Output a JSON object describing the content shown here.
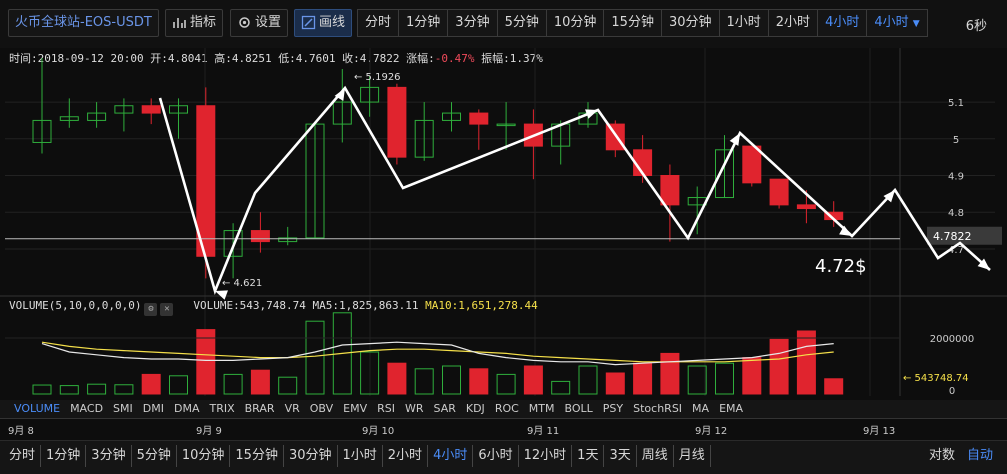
{
  "toolbar": {
    "title": "火币全球站-EOS-USDT",
    "indicators_label": "指标",
    "settings_label": "设置",
    "draw_label": "画线",
    "periods": [
      "分时",
      "1分钟",
      "3分钟",
      "5分钟",
      "10分钟",
      "15分钟",
      "30分钟",
      "1小时",
      "2小时",
      "4小时"
    ],
    "selected_period": "4小时",
    "period_dropdown": "4小时",
    "timer": "6秒"
  },
  "info_bar": {
    "time": "时间:2018-09-12 20:00",
    "open": "开:4.8041",
    "high": "高:4.8251",
    "low": "低:4.7601",
    "close": "收:4.7822",
    "change_label": "涨幅:",
    "change_value": "-0.47%",
    "amplitude": "振幅:1.37%"
  },
  "price_axis": {
    "ticks": [
      "5.1",
      "5",
      "4.9",
      "4.8",
      "4.7"
    ],
    "current_price": "4.7822",
    "annotation": "4.72$",
    "high_marker": "5.1926",
    "low_marker": "4.621"
  },
  "volume_bar": {
    "params": "VOLUME(5,10,0,0,0,0)",
    "volume": "VOLUME:543,748.74",
    "ma5": "MA5:1,825,863.11",
    "ma10": "MA10:1,651,278.44",
    "axis_tick": "2000000",
    "axis_zero": "0",
    "current_volume": "543748.74"
  },
  "indicator_tabs": [
    "VOLUME",
    "MACD",
    "SMI",
    "DMI",
    "DMA",
    "TRIX",
    "BRAR",
    "VR",
    "OBV",
    "EMV",
    "RSI",
    "WR",
    "SAR",
    "KDJ",
    "ROC",
    "MTM",
    "BOLL",
    "PSY",
    "StochRSI",
    "MA",
    "EMA"
  ],
  "selected_indicator": "VOLUME",
  "date_axis": [
    "9月 8",
    "9月 9",
    "9月 10",
    "9月 11",
    "9月 12",
    "9月 13"
  ],
  "bottom_periods": [
    "分时",
    "1分钟",
    "3分钟",
    "5分钟",
    "10分钟",
    "15分钟",
    "30分钟",
    "1小时",
    "2小时",
    "4小时",
    "6小时",
    "12小时",
    "1天",
    "3天",
    "周线",
    "月线"
  ],
  "bottom_selected": "4小时",
  "bottom_right": [
    "对数",
    "自动"
  ],
  "bottom_right_selected": "自动",
  "colors": {
    "up": "#2fae3c",
    "down": "#e0242e",
    "ma5": "#e8e8e8",
    "ma10": "#f5e04a",
    "accent": "#4a8cf7"
  },
  "chart_data": {
    "type": "candlestick",
    "candles": [
      {
        "o": 4.99,
        "h": 5.22,
        "l": 4.96,
        "c": 5.05,
        "v": 320000
      },
      {
        "o": 5.05,
        "h": 5.11,
        "l": 5.03,
        "c": 5.06,
        "v": 300000
      },
      {
        "o": 5.05,
        "h": 5.1,
        "l": 5.03,
        "c": 5.07,
        "v": 350000
      },
      {
        "o": 5.07,
        "h": 5.11,
        "l": 5.02,
        "c": 5.09,
        "v": 330000
      },
      {
        "o": 5.09,
        "h": 5.11,
        "l": 5.04,
        "c": 5.07,
        "v": 700000
      },
      {
        "o": 5.07,
        "h": 5.11,
        "l": 5.0,
        "c": 5.09,
        "v": 650000
      },
      {
        "o": 5.09,
        "h": 5.14,
        "l": 4.62,
        "c": 4.68,
        "v": 2300000
      },
      {
        "o": 4.68,
        "h": 4.77,
        "l": 4.62,
        "c": 4.75,
        "v": 700000
      },
      {
        "o": 4.75,
        "h": 4.8,
        "l": 4.69,
        "c": 4.72,
        "v": 850000
      },
      {
        "o": 4.72,
        "h": 4.76,
        "l": 4.71,
        "c": 4.73,
        "v": 600000
      },
      {
        "o": 4.73,
        "h": 5.04,
        "l": 4.73,
        "c": 5.04,
        "v": 2600000
      },
      {
        "o": 5.04,
        "h": 5.19,
        "l": 4.99,
        "c": 5.1,
        "v": 2900000
      },
      {
        "o": 5.1,
        "h": 5.17,
        "l": 5.06,
        "c": 5.14,
        "v": 1500000
      },
      {
        "o": 5.14,
        "h": 5.15,
        "l": 4.93,
        "c": 4.95,
        "v": 1100000
      },
      {
        "o": 4.95,
        "h": 5.1,
        "l": 4.94,
        "c": 5.05,
        "v": 900000
      },
      {
        "o": 5.05,
        "h": 5.1,
        "l": 5.02,
        "c": 5.07,
        "v": 1000000
      },
      {
        "o": 5.07,
        "h": 5.08,
        "l": 4.97,
        "c": 5.04,
        "v": 900000
      },
      {
        "o": 5.04,
        "h": 5.1,
        "l": 4.97,
        "c": 5.04,
        "v": 700000
      },
      {
        "o": 5.04,
        "h": 5.08,
        "l": 4.89,
        "c": 4.98,
        "v": 1000000
      },
      {
        "o": 4.98,
        "h": 5.05,
        "l": 4.93,
        "c": 5.04,
        "v": 450000
      },
      {
        "o": 5.04,
        "h": 5.1,
        "l": 5.03,
        "c": 5.07,
        "v": 1000000
      },
      {
        "o": 5.04,
        "h": 5.05,
        "l": 4.95,
        "c": 4.97,
        "v": 750000
      },
      {
        "o": 4.97,
        "h": 5.01,
        "l": 4.88,
        "c": 4.9,
        "v": 1100000
      },
      {
        "o": 4.9,
        "h": 4.93,
        "l": 4.72,
        "c": 4.82,
        "v": 1450000
      },
      {
        "o": 4.82,
        "h": 4.87,
        "l": 4.74,
        "c": 4.84,
        "v": 1000000
      },
      {
        "o": 4.84,
        "h": 5.01,
        "l": 4.84,
        "c": 4.97,
        "v": 1100000
      },
      {
        "o": 4.98,
        "h": 4.98,
        "l": 4.87,
        "c": 4.88,
        "v": 1300000
      },
      {
        "o": 4.89,
        "h": 4.89,
        "l": 4.81,
        "c": 4.82,
        "v": 1950000
      },
      {
        "o": 4.82,
        "h": 4.86,
        "l": 4.77,
        "c": 4.81,
        "v": 2250000
      },
      {
        "o": 4.8,
        "h": 4.83,
        "l": 4.76,
        "c": 4.78,
        "v": 543748.74
      }
    ],
    "ma5": [
      1800000,
      1500000,
      1400000,
      1300000,
      1250000,
      1250000,
      1200000,
      1200000,
      1250000,
      1300000,
      1500000,
      1750000,
      1800000,
      1850000,
      1800000,
      1750000,
      1450000,
      1300000,
      1200000,
      1150000,
      1150000,
      1050000,
      1100000,
      1150000,
      1200000,
      1250000,
      1300000,
      1450000,
      1700000,
      1800000
    ],
    "ma10": [
      1850000,
      1700000,
      1600000,
      1550000,
      1500000,
      1450000,
      1400000,
      1350000,
      1300000,
      1300000,
      1350000,
      1450000,
      1550000,
      1600000,
      1600000,
      1550000,
      1500000,
      1450000,
      1350000,
      1300000,
      1250000,
      1200000,
      1150000,
      1150000,
      1150000,
      1150000,
      1200000,
      1250000,
      1400000,
      1500000
    ],
    "y_range": [
      4.58,
      5.22
    ],
    "v_range": [
      0,
      3000000
    ]
  }
}
